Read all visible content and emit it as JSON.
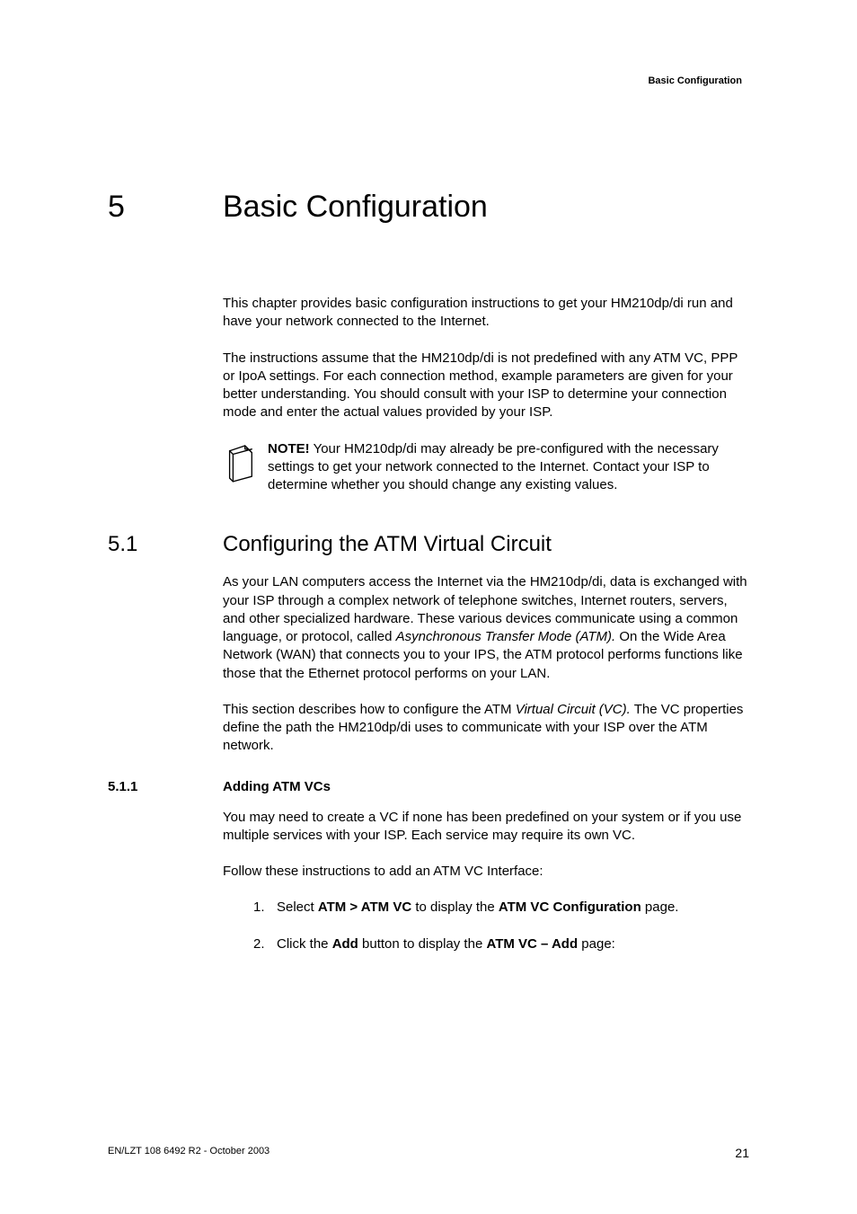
{
  "header": {
    "right": "Basic Configuration"
  },
  "chapter": {
    "num": "5",
    "title": "Basic Configuration"
  },
  "intro": {
    "p1": "This chapter provides basic configuration instructions to get your HM210dp/di run and have your network connected to the Internet.",
    "p2": "The instructions assume that the HM210dp/di is not predefined with any ATM VC, PPP or IpoA settings. For each connection method, example parameters are given for your better understanding. You should consult with your ISP to determine your connection mode and enter the actual values provided by your ISP."
  },
  "note": {
    "bold": "NOTE!",
    "text": " Your HM210dp/di may already be pre-configured with the necessary settings to get your network connected to the Internet. Contact your ISP to determine whether you should change any existing values."
  },
  "section51": {
    "num": "5.1",
    "title": "Configuring the ATM Virtual Circuit",
    "p1a": "As your LAN computers access the Internet via the HM210dp/di, data is exchanged with your ISP through a complex network of telephone switches, Internet routers, servers, and other specialized hardware. These various devices communicate using a common language, or protocol, called ",
    "p1i": "Asynchronous Transfer Mode (ATM).",
    "p1b": " On the Wide Area Network (WAN) that connects you to your IPS, the ATM protocol performs functions like those that the Ethernet protocol performs on your LAN.",
    "p2a": "This section describes how to configure the ATM ",
    "p2i": "Virtual Circuit (VC).",
    "p2b": " The VC properties define the path the HM210dp/di uses to communicate with your ISP over the ATM network."
  },
  "section511": {
    "num": "5.1.1",
    "title": "Adding ATM VCs",
    "p1": "You may need to create a VC if none has been predefined on your system or if you use multiple services with your ISP. Each service may require its own VC.",
    "p2": "Follow these instructions to add an ATM VC Interface:",
    "li1": {
      "n": "1.",
      "a": "Select ",
      "b1": "ATM > ATM VC",
      "b": " to display the ",
      "b2": "ATM VC Configuration",
      "c": " page."
    },
    "li2": {
      "n": "2.",
      "a": "Click the ",
      "b1": "Add",
      "b": " button to display the ",
      "b2": "ATM VC – Add",
      "c": " page:"
    }
  },
  "footer": {
    "left": "EN/LZT 108 6492 R2 - October 2003",
    "right": "21"
  }
}
